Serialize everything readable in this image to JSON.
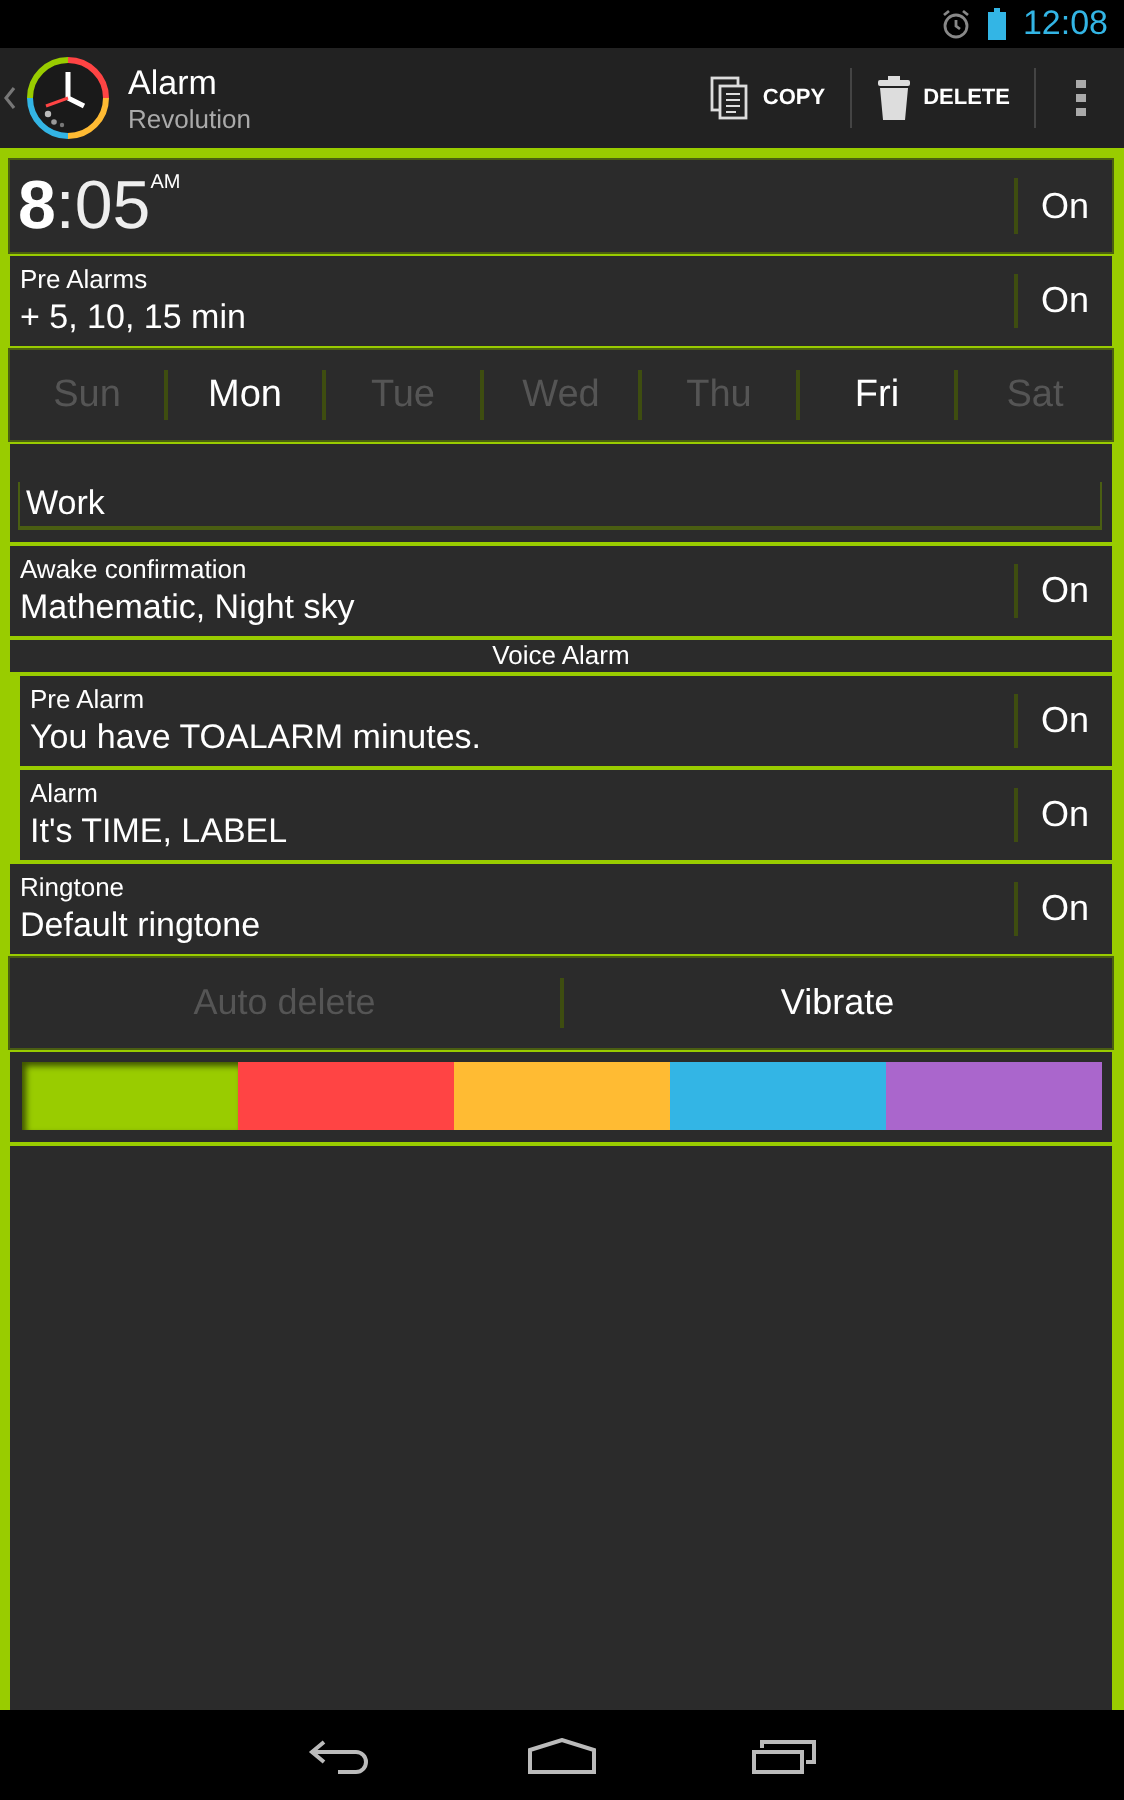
{
  "status_bar": {
    "time": "12:08"
  },
  "action_bar": {
    "title": "Alarm",
    "subtitle": "Revolution",
    "actions": [
      {
        "kind": "copy",
        "label": "COPY"
      },
      {
        "kind": "delete",
        "label": "DELETE"
      }
    ]
  },
  "time_row": {
    "hour": "8",
    "minutes": ":05",
    "ampm": "AM",
    "toggle": "On"
  },
  "pre_alarms": {
    "title": "Pre Alarms",
    "value": "+ 5, 10, 15 min",
    "toggle": "On"
  },
  "days": [
    {
      "label": "Sun",
      "selected": false
    },
    {
      "label": "Mon",
      "selected": true
    },
    {
      "label": "Tue",
      "selected": false
    },
    {
      "label": "Wed",
      "selected": false
    },
    {
      "label": "Thu",
      "selected": false
    },
    {
      "label": "Fri",
      "selected": true
    },
    {
      "label": "Sat",
      "selected": false
    }
  ],
  "label_field": {
    "value": "Work"
  },
  "awake_confirmation": {
    "title": "Awake confirmation",
    "value": "Mathematic, Night sky",
    "toggle": "On"
  },
  "voice_alarm": {
    "title": "Voice Alarm",
    "items": [
      {
        "title": "Pre Alarm",
        "value": "You have TOALARM minutes.",
        "toggle": "On"
      },
      {
        "title": "Alarm",
        "value": "It's TIME, LABEL",
        "toggle": "On"
      }
    ]
  },
  "ringtone": {
    "title": "Ringtone",
    "value": "Default ringtone",
    "toggle": "On"
  },
  "options": [
    {
      "label": "Auto delete",
      "on": false
    },
    {
      "label": "Vibrate",
      "on": true
    }
  ],
  "colors": [
    {
      "color": "#99cc00",
      "selected": true
    },
    {
      "color": "#ff4444",
      "selected": false
    },
    {
      "color": "#ffbb33",
      "selected": false
    },
    {
      "color": "#33b5e5",
      "selected": false
    },
    {
      "color": "#aa66cc",
      "selected": false
    }
  ]
}
